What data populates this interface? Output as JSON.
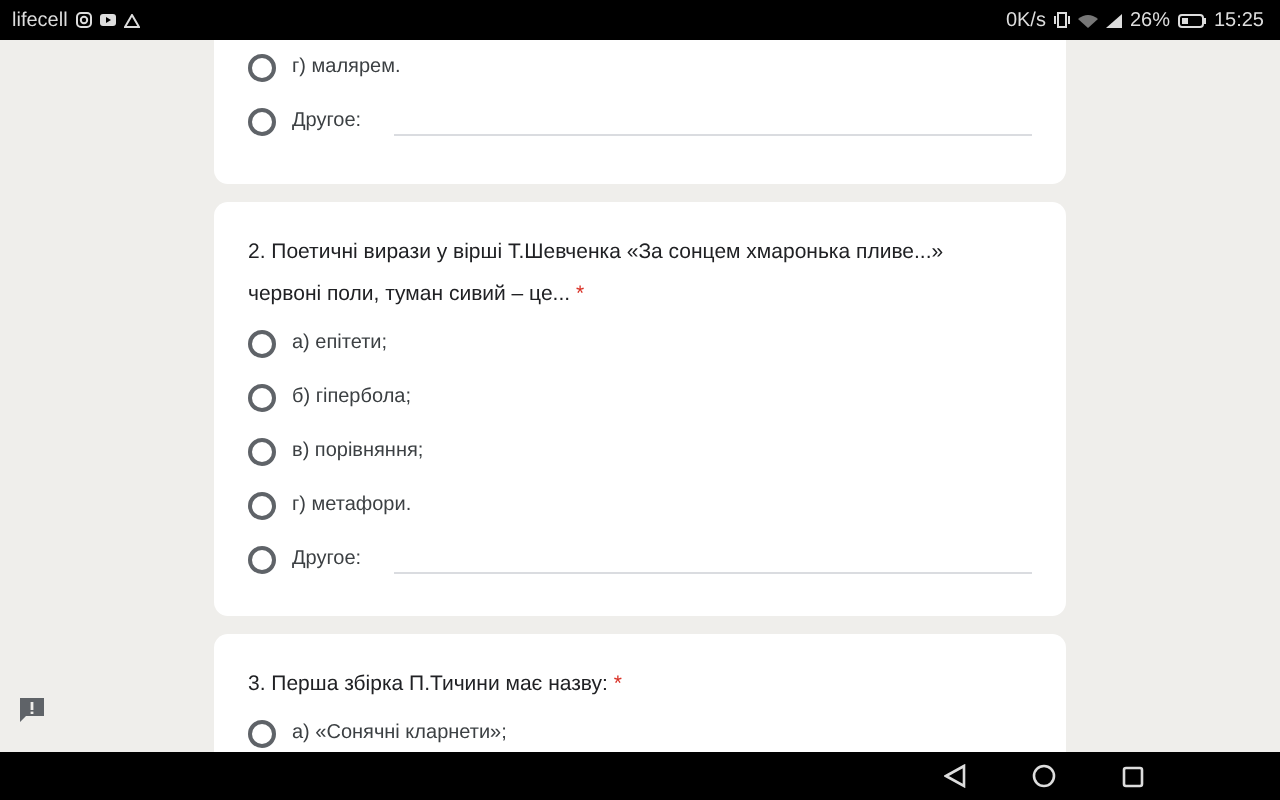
{
  "status_bar": {
    "carrier": "lifecell",
    "speed": "0K/s",
    "battery": "26%",
    "time": "15:25"
  },
  "questions": [
    {
      "options": [
        {
          "label": "г) малярем.",
          "kind": "choice",
          "selected": false
        },
        {
          "label": "Другое:",
          "kind": "other",
          "selected": false
        }
      ]
    },
    {
      "title": "2. Поетичні вирази у вірші Т.Шевченка «За сонцем хмаронька пливе...» червоні поли, туман сивий – це...",
      "required_mark": "*",
      "options": [
        {
          "label": "а) епітети;",
          "kind": "choice",
          "selected": false
        },
        {
          "label": "б) гіпербола;",
          "kind": "choice",
          "selected": false
        },
        {
          "label": "в) порівняння;",
          "kind": "choice",
          "selected": false
        },
        {
          "label": "г) метафори.",
          "kind": "choice",
          "selected": false
        },
        {
          "label": "Другое:",
          "kind": "other",
          "selected": false
        }
      ]
    },
    {
      "title": "3. Перша збірка П.Тичини має назву:",
      "required_mark": "*",
      "options": [
        {
          "label": "а) «Сонячні кларнети»;",
          "kind": "choice",
          "selected": false
        }
      ]
    }
  ]
}
